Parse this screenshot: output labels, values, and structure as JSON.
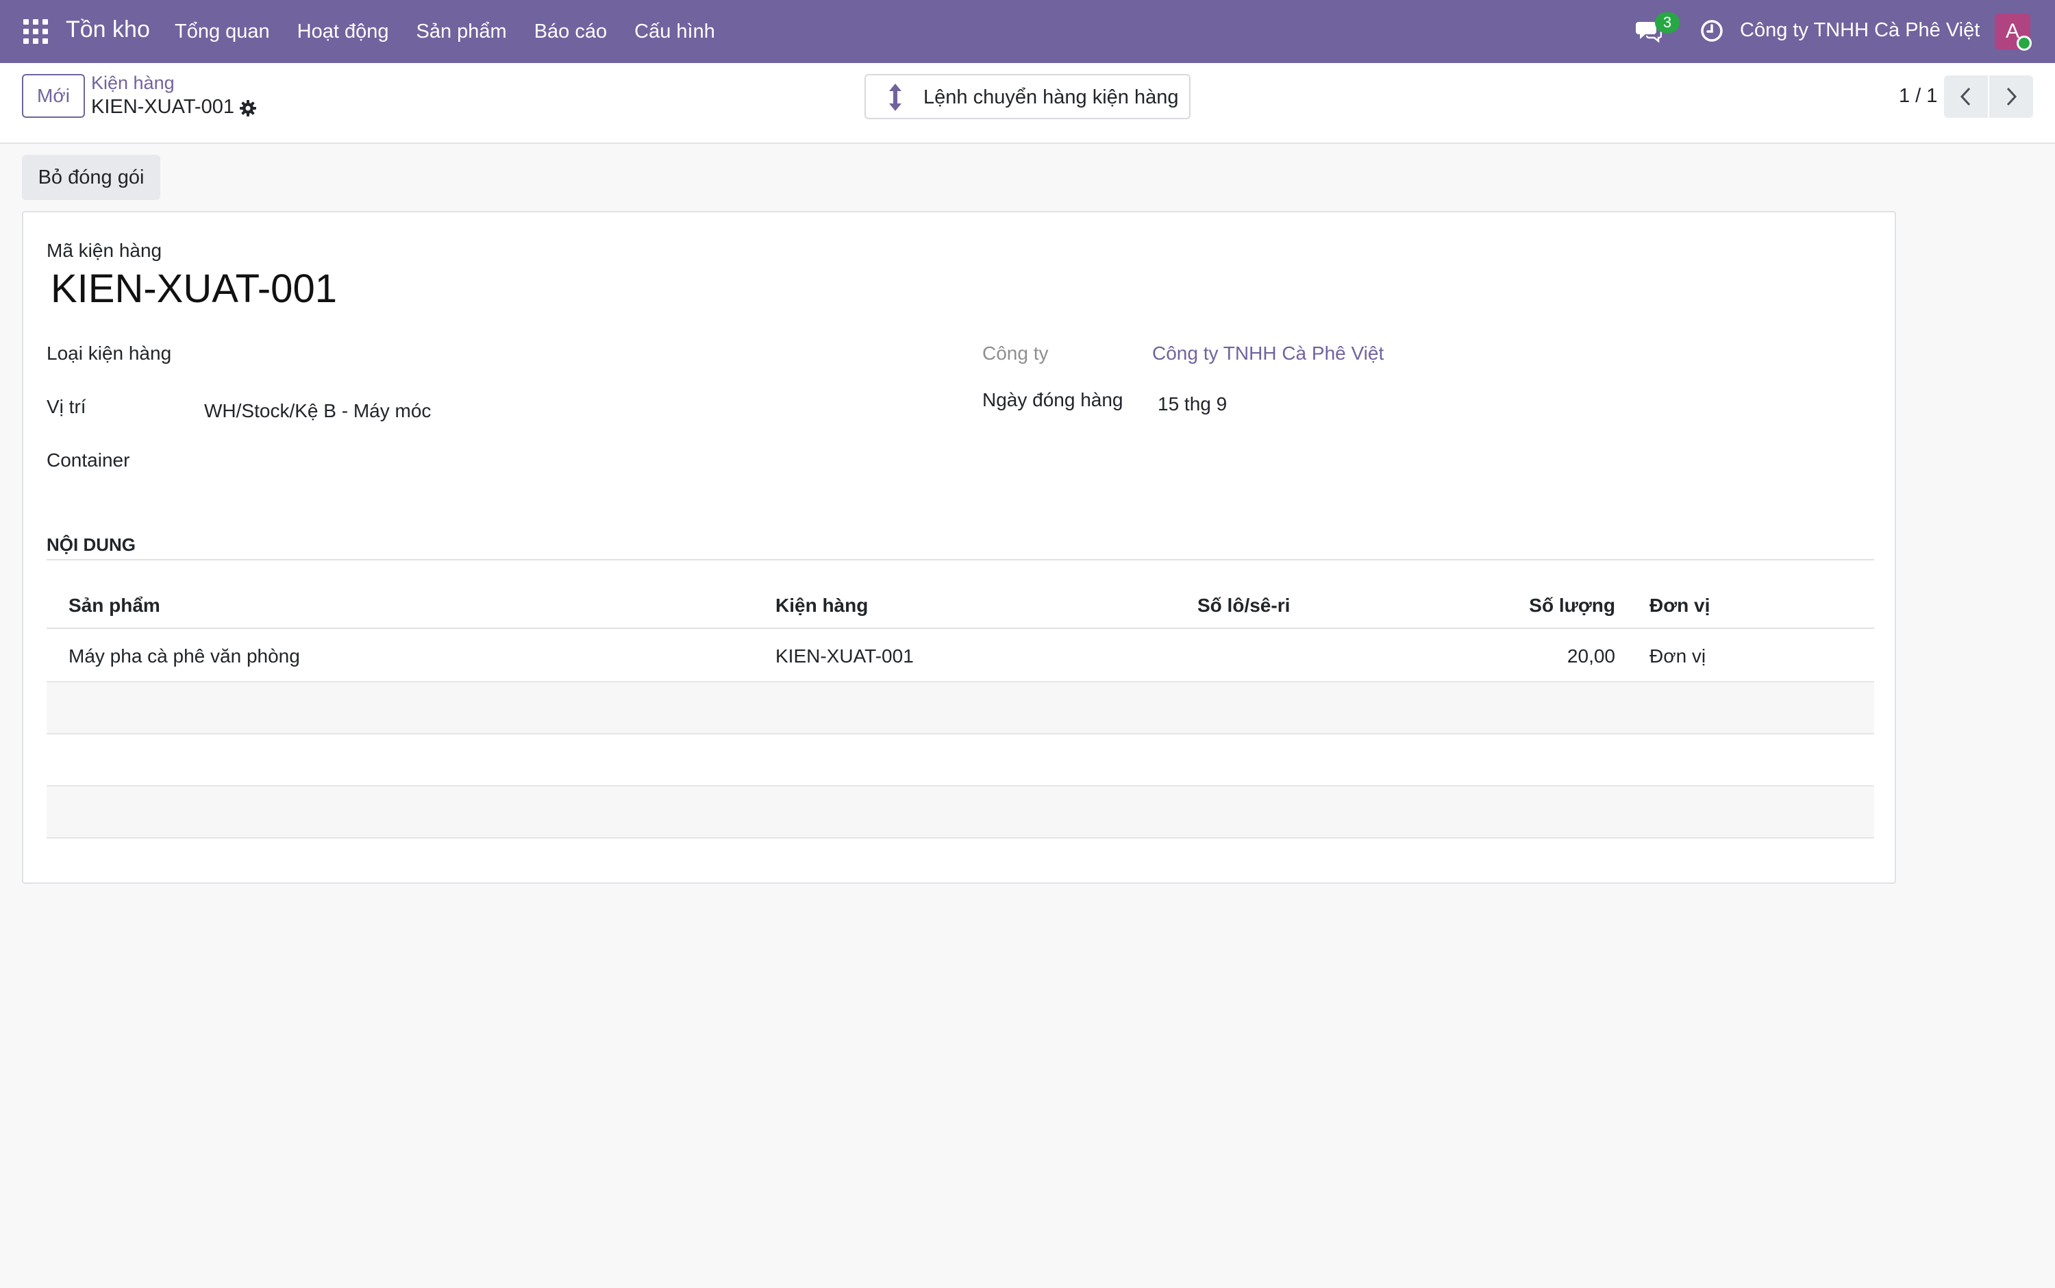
{
  "navbar": {
    "app_name": "Tồn kho",
    "menu": [
      "Tổng quan",
      "Hoạt động",
      "Sản phẩm",
      "Báo cáo",
      "Cấu hình"
    ],
    "chat_count": "3",
    "company": "Công ty TNHH Cà Phê Việt",
    "avatar_initial": "A",
    "colors": {
      "navbar_bg": "#71639e",
      "badge": "#28a745",
      "avatar_bg": "#b04480"
    }
  },
  "control_panel": {
    "new_button": "Mới",
    "breadcrumb_parent": "Kiện hàng",
    "breadcrumb_current": "KIEN-XUAT-001",
    "smart_button": "Lệnh chuyển hàng kiện hàng",
    "pager": "1 / 1"
  },
  "statusbar": {
    "unpack_button": "Bỏ đóng gói"
  },
  "form": {
    "name_label": "Mã kiện hàng",
    "name_value": "KIEN-XUAT-001",
    "package_type_label": "Loại kiện hàng",
    "package_type_value": "",
    "location_label": "Vị trí",
    "location_value": "WH/Stock/Kệ B - Máy móc",
    "container_label": "Container",
    "container_value": "",
    "company_label": "Công ty",
    "company_value": "Công ty TNHH Cà Phê Việt",
    "pack_date_label": "Ngày đóng hàng",
    "pack_date_value": "15 thg 9",
    "section_title": "NỘI DUNG"
  },
  "content_table": {
    "columns": [
      "Sản phẩm",
      "Kiện hàng",
      "Số lô/sê-ri",
      "Số lượng",
      "Đơn vị"
    ],
    "rows": [
      [
        "Máy pha cà phê văn phòng",
        "KIEN-XUAT-001",
        "",
        "20,00",
        "Đơn vị"
      ]
    ]
  }
}
